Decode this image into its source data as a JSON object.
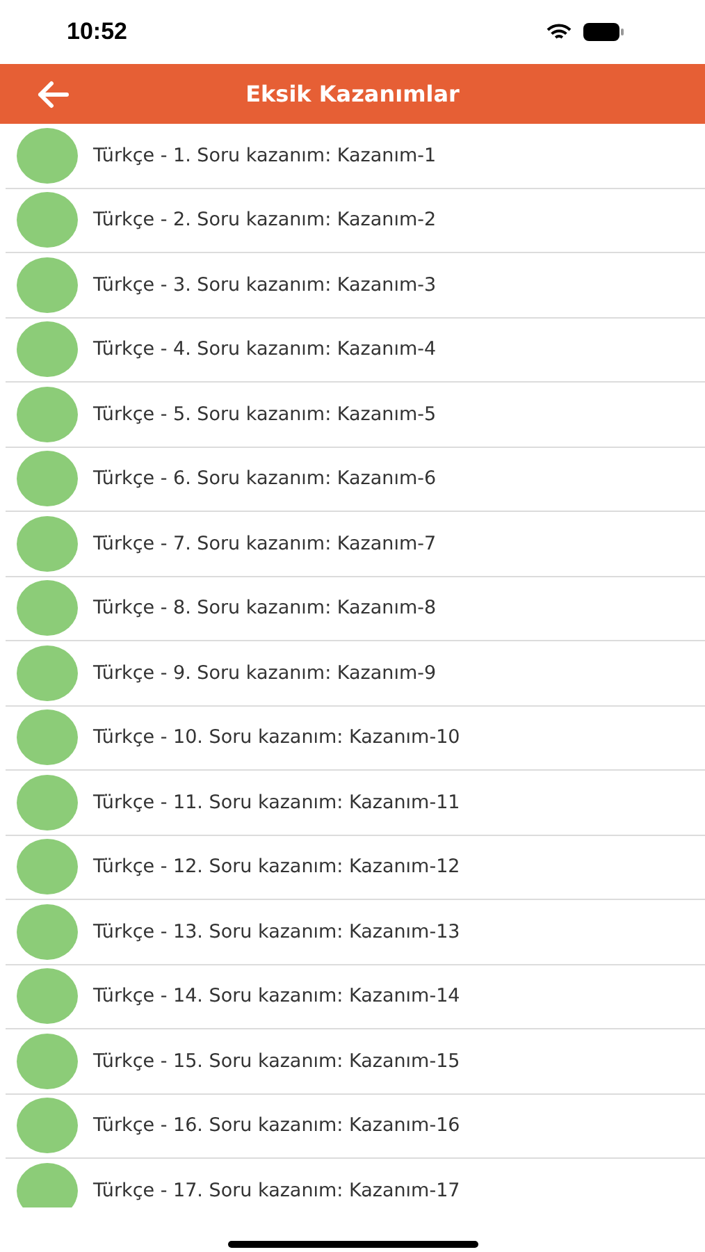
{
  "status_bar": {
    "time": "10:52"
  },
  "header": {
    "title": "Eksik Kazanımlar"
  },
  "items": [
    {
      "text": "Türkçe - 1. Soru kazanım: Kazanım-1"
    },
    {
      "text": "Türkçe - 2. Soru kazanım: Kazanım-2"
    },
    {
      "text": "Türkçe - 3. Soru kazanım: Kazanım-3"
    },
    {
      "text": "Türkçe - 4. Soru kazanım: Kazanım-4"
    },
    {
      "text": "Türkçe - 5. Soru kazanım: Kazanım-5"
    },
    {
      "text": "Türkçe - 6. Soru kazanım: Kazanım-6"
    },
    {
      "text": "Türkçe - 7. Soru kazanım: Kazanım-7"
    },
    {
      "text": "Türkçe - 8. Soru kazanım: Kazanım-8"
    },
    {
      "text": "Türkçe - 9. Soru kazanım: Kazanım-9"
    },
    {
      "text": "Türkçe - 10. Soru kazanım: Kazanım-10"
    },
    {
      "text": "Türkçe - 11. Soru kazanım: Kazanım-11"
    },
    {
      "text": "Türkçe - 12. Soru kazanım: Kazanım-12"
    },
    {
      "text": "Türkçe - 13. Soru kazanım: Kazanım-13"
    },
    {
      "text": "Türkçe - 14. Soru kazanım: Kazanım-14"
    },
    {
      "text": "Türkçe - 15. Soru kazanım: Kazanım-15"
    },
    {
      "text": "Türkçe - 16. Soru kazanım: Kazanım-16"
    },
    {
      "text": "Türkçe - 17. Soru kazanım: Kazanım-17"
    }
  ]
}
